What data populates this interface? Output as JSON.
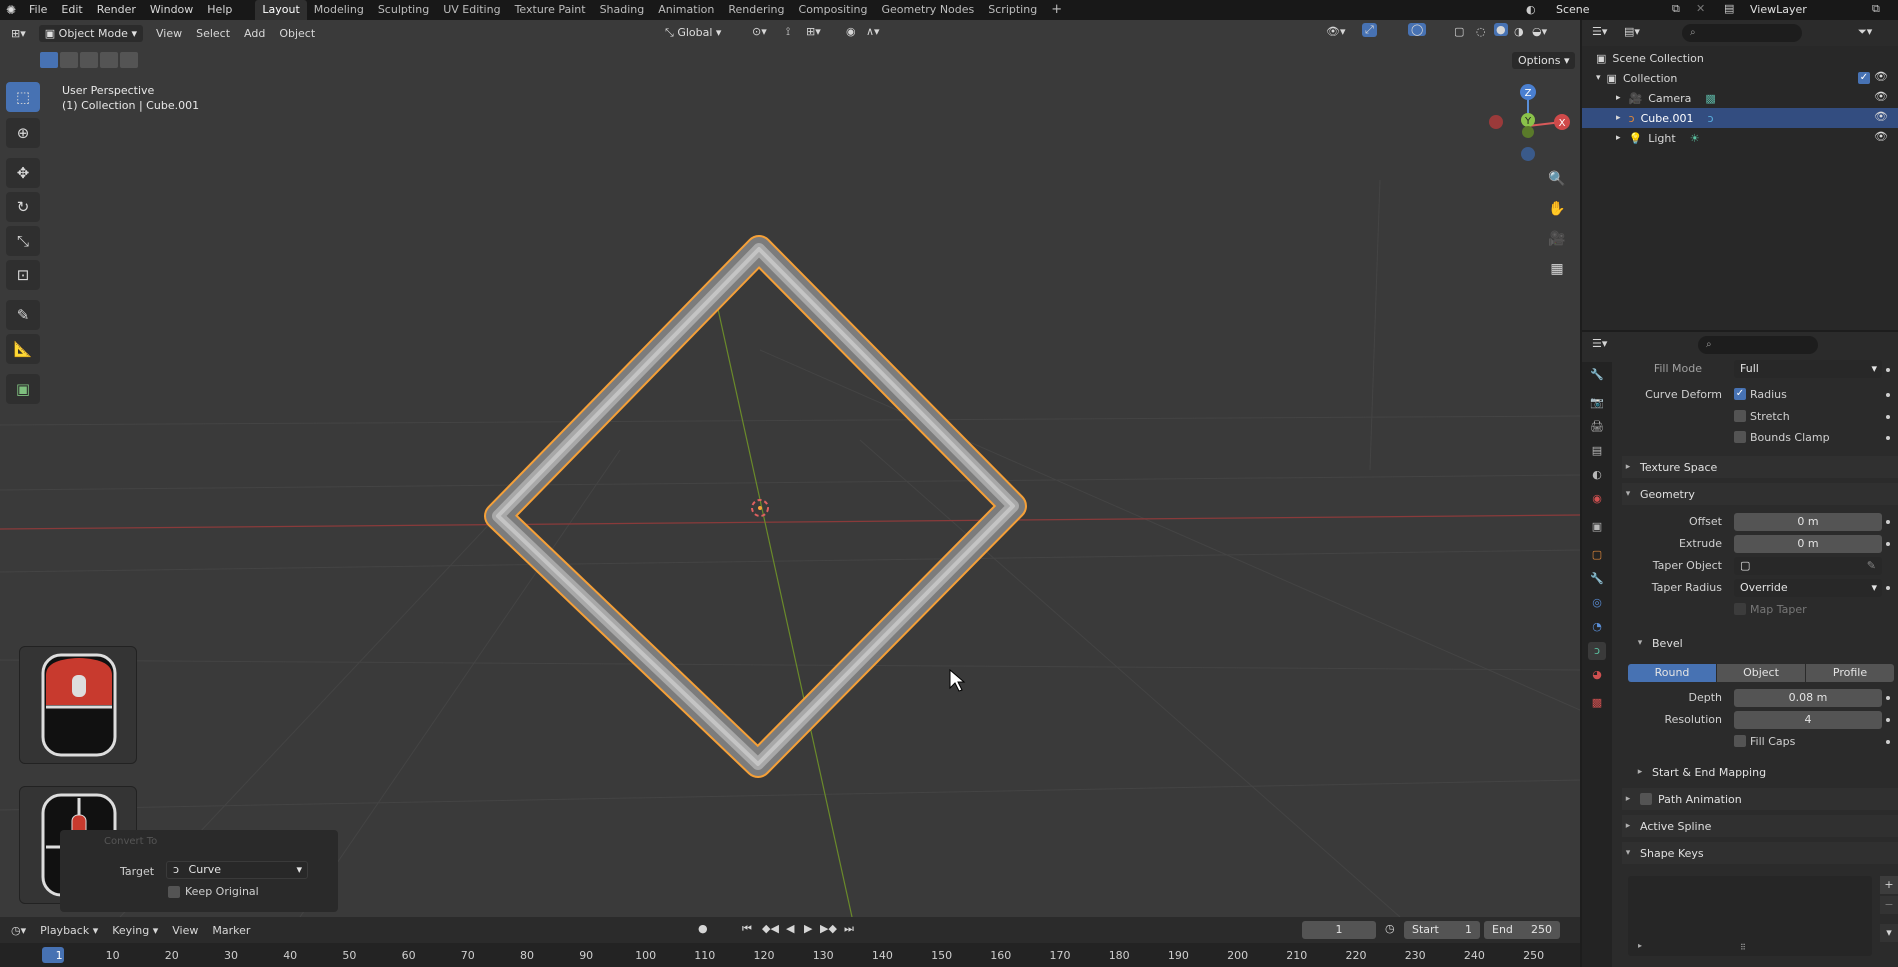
{
  "topbar": {
    "menus": [
      "File",
      "Edit",
      "Render",
      "Window",
      "Help"
    ],
    "workspaces": [
      "Layout",
      "Modeling",
      "Sculpting",
      "UV Editing",
      "Texture Paint",
      "Shading",
      "Animation",
      "Rendering",
      "Compositing",
      "Geometry Nodes",
      "Scripting"
    ],
    "active_workspace": "Layout",
    "scene": "Scene",
    "view_layer": "ViewLayer"
  },
  "viewport": {
    "mode": "Object Mode",
    "menus": [
      "View",
      "Select",
      "Add",
      "Object"
    ],
    "orientation": "Global",
    "options_label": "Options",
    "overlay_line1": "User Perspective",
    "overlay_line2": "(1) Collection | Cube.001",
    "gizmo_axes": [
      "Z",
      "Y",
      "X"
    ]
  },
  "operator_panel": {
    "title": "Convert To",
    "target_label": "Target",
    "target_value": "Curve",
    "keep_original_label": "Keep Original"
  },
  "outliner": {
    "scene_collection": "Scene Collection",
    "collection": "Collection",
    "items": [
      {
        "name": "Camera",
        "selected": false
      },
      {
        "name": "Cube.001",
        "selected": true
      },
      {
        "name": "Light",
        "selected": false
      }
    ]
  },
  "properties": {
    "fill_mode_label": "Fill Mode",
    "fill_mode_value": "Full",
    "curve_deform_label": "Curve Deform",
    "radius_label": "Radius",
    "stretch_label": "Stretch",
    "bounds_clamp_label": "Bounds Clamp",
    "texture_space": "Texture Space",
    "geometry": "Geometry",
    "offset_label": "Offset",
    "offset_value": "0 m",
    "extrude_label": "Extrude",
    "extrude_value": "0 m",
    "taper_object_label": "Taper Object",
    "taper_radius_label": "Taper Radius",
    "taper_radius_value": "Override",
    "map_taper_label": "Map Taper",
    "bevel": "Bevel",
    "bevel_modes": [
      "Round",
      "Object",
      "Profile"
    ],
    "bevel_mode_active": "Round",
    "depth_label": "Depth",
    "depth_value": "0.08 m",
    "resolution_label": "Resolution",
    "resolution_value": "4",
    "fill_caps_label": "Fill Caps",
    "start_end_mapping": "Start & End Mapping",
    "path_animation": "Path Animation",
    "active_spline": "Active Spline",
    "shape_keys": "Shape Keys"
  },
  "timeline": {
    "menus": [
      "Playback",
      "Keying",
      "View",
      "Marker"
    ],
    "current_frame": "1",
    "start_label": "Start",
    "start_value": "1",
    "end_label": "End",
    "end_value": "250",
    "ticks": [
      "1",
      "10",
      "20",
      "30",
      "40",
      "50",
      "60",
      "70",
      "80",
      "90",
      "100",
      "110",
      "120",
      "130",
      "140",
      "150",
      "160",
      "170",
      "180",
      "190",
      "200",
      "210",
      "220",
      "230",
      "240",
      "250"
    ]
  },
  "colors": {
    "accent": "#4772b3",
    "selection_outline": "#f5a038",
    "viewport_bg": "#3a3a3a"
  }
}
